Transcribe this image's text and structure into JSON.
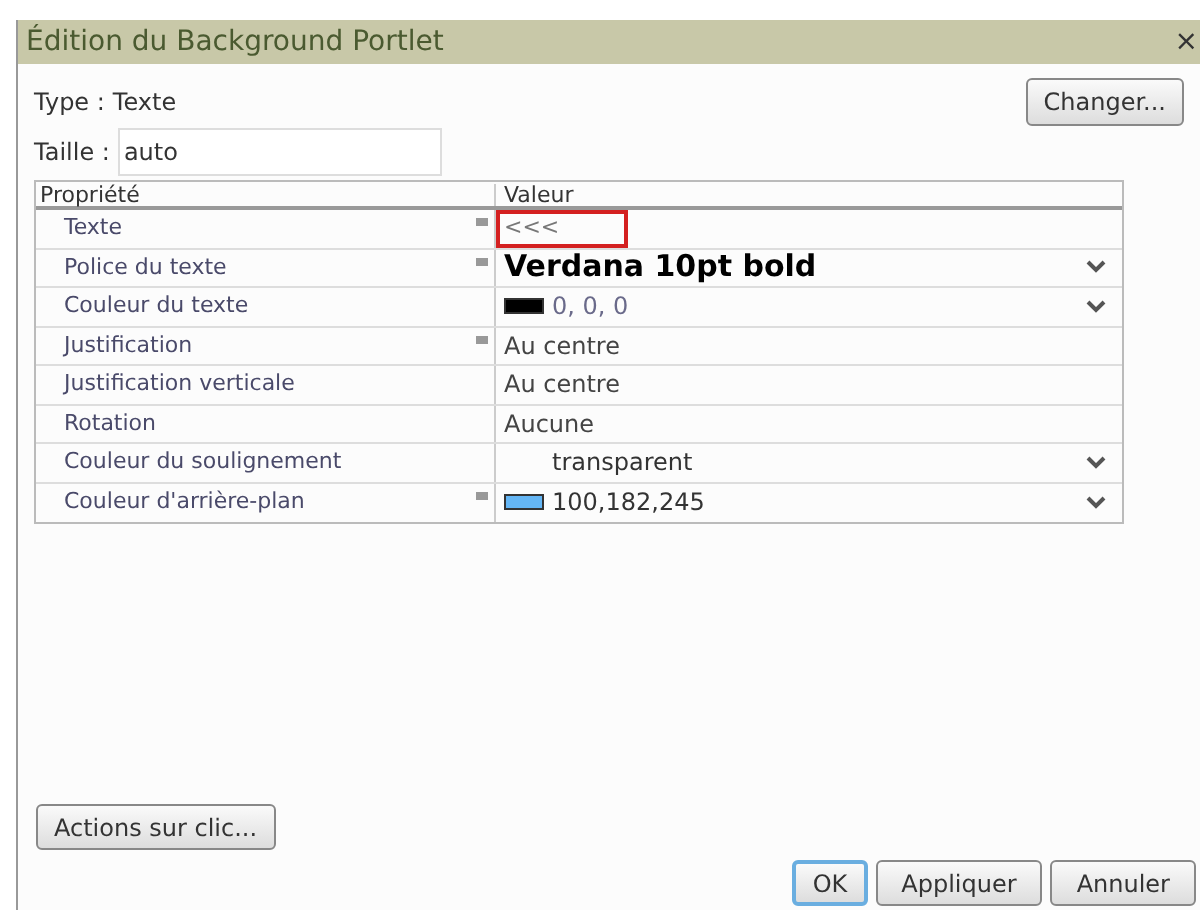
{
  "window": {
    "title": "Édition du Background Portlet",
    "close": "×"
  },
  "type_label": "Type :",
  "type_value": "Texte",
  "change_button": "Changer...",
  "size_label": "Taille :",
  "size_value": "auto",
  "table": {
    "columns": [
      "Propriété",
      "Valeur"
    ],
    "rows": [
      {
        "label": "Texte",
        "required": true,
        "kind": "text",
        "value": "<<<",
        "dropdown": false,
        "highlighted": true
      },
      {
        "label": "Police du texte",
        "required": true,
        "kind": "bold",
        "value": "Verdana 10pt bold",
        "dropdown": true,
        "highlighted": false
      },
      {
        "label": "Couleur du texte",
        "required": false,
        "kind": "swatch",
        "color": "#000000",
        "value": "0, 0, 0",
        "dropdown": true,
        "highlighted": false
      },
      {
        "label": "Justification",
        "required": true,
        "kind": "plain",
        "value": "Au centre",
        "dropdown": false,
        "highlighted": false
      },
      {
        "label": "Justification verticale",
        "required": false,
        "kind": "plain",
        "value": "Au centre",
        "dropdown": false,
        "highlighted": false
      },
      {
        "label": "Rotation",
        "required": false,
        "kind": "plain",
        "value": "Aucune",
        "dropdown": false,
        "highlighted": false
      },
      {
        "label": "Couleur du soulignement",
        "required": false,
        "kind": "swatch",
        "value": "transparent",
        "dropdown": true,
        "highlighted": false
      },
      {
        "label": "Couleur d'arrière-plan",
        "required": true,
        "kind": "swatch",
        "color": "#64b6f5",
        "value": "100,182,245",
        "dropdown": true,
        "highlighted": false
      }
    ]
  },
  "actions_button": "Actions sur clic...",
  "buttons": [
    {
      "label": "OK",
      "default": true
    },
    {
      "label": "Appliquer",
      "default": false
    },
    {
      "label": "Annuler",
      "default": false
    }
  ]
}
